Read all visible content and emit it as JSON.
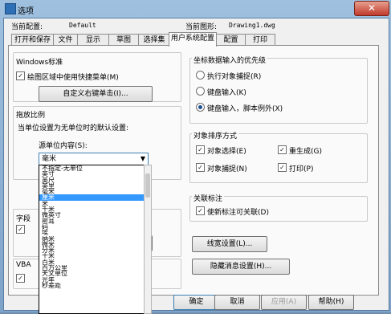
{
  "window": {
    "title": "选项",
    "close": "✕"
  },
  "header": {
    "current_profile_label": "当前配置:",
    "current_profile_value": "Default",
    "current_drawing_label": "当前图形:",
    "current_drawing_value": "Drawing1.dwg"
  },
  "tabs": [
    "打开和保存",
    "文件",
    "显示",
    "草图",
    "选择集",
    "用户系统配置",
    "配置",
    "打印"
  ],
  "active_tab_index": 5,
  "windows_std": {
    "title": "Windows标准",
    "shortcut_menu": "绘图区域中使用快捷菜单(M)",
    "right_click_button": "自定义右键单击(I)..."
  },
  "drag_scale": {
    "title": "拖放比例",
    "subtitle": "当单位设置为无单位时的默认设置:",
    "source_label": "源单位内容(S):",
    "source_value": "毫米"
  },
  "unit_options": [
    "不指定-无单位",
    "英寸",
    "英尺",
    "英里",
    "毫米",
    "厘米",
    "米",
    "千米",
    "微英寸",
    "密耳",
    "码",
    "埃",
    "纳米",
    "微米",
    "分米",
    "十米",
    "百米",
    "百万公里",
    "天文单位",
    "光年",
    "秒差距"
  ],
  "selected_unit_index": 5,
  "hidden_partial": {
    "fields": "字段",
    "vba": "VBA"
  },
  "coord_priority": {
    "title": "坐标数据输入的优先级",
    "opt1": "执行对象捕捉(R)",
    "opt2": "键盘输入(K)",
    "opt3": "键盘输入，脚本例外(X)"
  },
  "object_sort": {
    "title": "对象排序方式",
    "select": "对象选择(E)",
    "regen": "重生成(G)",
    "snap": "对象捕捉(N)",
    "plot": "打印(P)"
  },
  "assoc_dim": {
    "title": "关联标注",
    "make_assoc": "使新标注可关联(D)"
  },
  "lineweight_btn": "线宽设置(L)...",
  "hidden_msg_btn": "隐藏消息设置(H)...",
  "footer": {
    "ok": "确定",
    "cancel": "取消",
    "apply": "应用(A)",
    "help": "帮助(H)"
  }
}
